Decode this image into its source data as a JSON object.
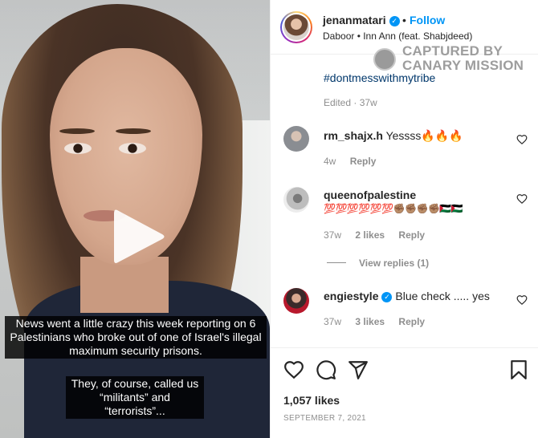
{
  "post": {
    "username": "jenanmatari",
    "follow_label": "Follow",
    "separator": "•",
    "audio": "Daboor • Inn Ann (feat. Shabjdeed)",
    "hashtag": "#dontmesswithmytribe",
    "edited": "Edited · 37w",
    "likes": "1,057 likes",
    "date": "SEPTEMBER 7, 2021"
  },
  "watermark": {
    "line1": "CAPTURED BY",
    "line2": "CANARY MISSION"
  },
  "video": {
    "caption1": "News went a little crazy this week reporting on 6 Palestinians who broke out of one of Israel's illegal maximum security prisons.",
    "caption2": "They, of course, called us “militants” and “terrorists”..."
  },
  "comments": [
    {
      "user": "rm_shajx.h",
      "text": "Yessss🔥🔥🔥",
      "time": "4w",
      "likes": "",
      "reply": "Reply"
    },
    {
      "user": "queenofpalestine",
      "text": "💯💯💯💯💯💯✊🏽✊🏽✊🏽✊🏽🇵🇸🇵🇸",
      "time": "37w",
      "likes": "2 likes",
      "reply": "Reply",
      "view_replies": "View replies (1)"
    },
    {
      "user": "engiestyle",
      "text": "Blue check ..... yes",
      "time": "37w",
      "likes": "3 likes",
      "reply": "Reply"
    }
  ],
  "icons": {
    "verified": "✓",
    "like": "heart-icon",
    "comment": "comment-icon",
    "share": "share-icon",
    "save": "bookmark-icon",
    "play": "play-icon"
  },
  "colors": {
    "link": "#0095f6",
    "hashtag": "#00376b",
    "muted": "#8e8e8e",
    "text": "#262626"
  }
}
